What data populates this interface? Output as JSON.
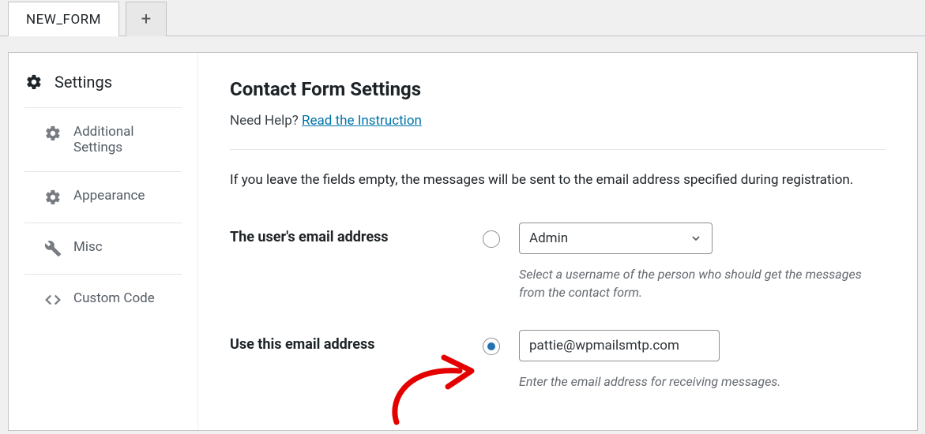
{
  "tabs": {
    "active": "NEW_FORM",
    "add": "+"
  },
  "sidebar": {
    "active": "Settings",
    "items": [
      "Additional Settings",
      "Appearance",
      "Misc",
      "Custom Code"
    ]
  },
  "content": {
    "title": "Contact Form Settings",
    "help_prefix": "Need Help? ",
    "help_link": "Read the Instruction",
    "intro": "If you leave the fields empty, the messages will be sent to the email address specified during registration.",
    "field1": {
      "label": "The user's email address",
      "select_value": "Admin",
      "hint": "Select a username of the person who should get the messages from the contact form."
    },
    "field2": {
      "label": "Use this email address",
      "input_value": "pattie@wpmailsmtp.com",
      "hint": "Enter the email address for receiving messages."
    }
  }
}
